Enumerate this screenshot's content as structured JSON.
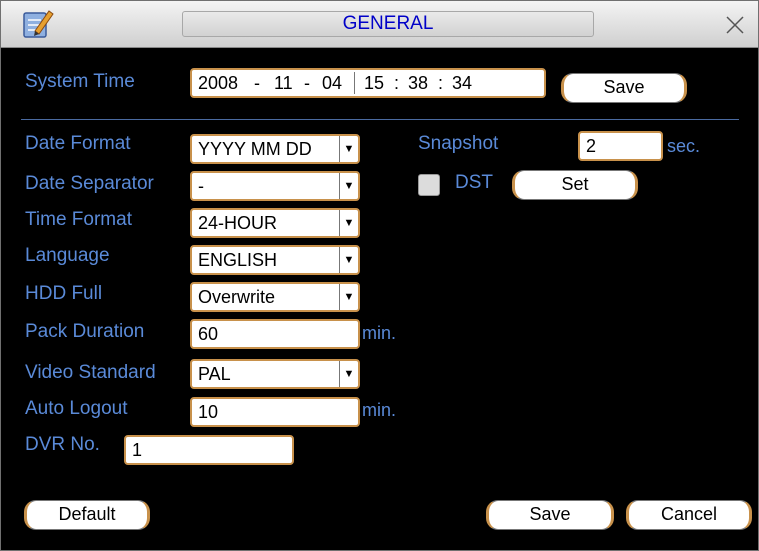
{
  "window": {
    "title": "GENERAL"
  },
  "icons": {
    "app": "edit-document-icon",
    "close": "close-x-icon"
  },
  "colors": {
    "label": "#5a8ad8",
    "title_text": "#0000c8",
    "field_border": "#c8914b",
    "background": "#000000"
  },
  "system_time": {
    "label": "System Time",
    "year": "2008",
    "sep1": "-",
    "month": "11",
    "sep2": "-",
    "day": "04",
    "hour": "15",
    "colon1": ":",
    "minute": "38",
    "colon2": ":",
    "second": "34",
    "save_label": "Save"
  },
  "settings": {
    "date_format": {
      "label": "Date Format",
      "value": "YYYY MM DD"
    },
    "date_separator": {
      "label": "Date Separator",
      "value": "-"
    },
    "time_format": {
      "label": "Time Format",
      "value": "24-HOUR"
    },
    "language": {
      "label": "Language",
      "value": "ENGLISH"
    },
    "hdd_full": {
      "label": "HDD Full",
      "value": "Overwrite"
    },
    "pack_duration": {
      "label": "Pack Duration",
      "value": "60",
      "unit": "min."
    },
    "video_standard": {
      "label": "Video Standard",
      "value": "PAL"
    },
    "auto_logout": {
      "label": "Auto Logout",
      "value": "10",
      "unit": "min."
    },
    "dvr_no": {
      "label": "DVR No.",
      "value": "1"
    },
    "snapshot": {
      "label": "Snapshot",
      "value": "2",
      "unit": "sec."
    },
    "dst": {
      "label": "DST",
      "checked": false,
      "set_label": "Set"
    }
  },
  "footer": {
    "default_label": "Default",
    "save_label": "Save",
    "cancel_label": "Cancel"
  }
}
